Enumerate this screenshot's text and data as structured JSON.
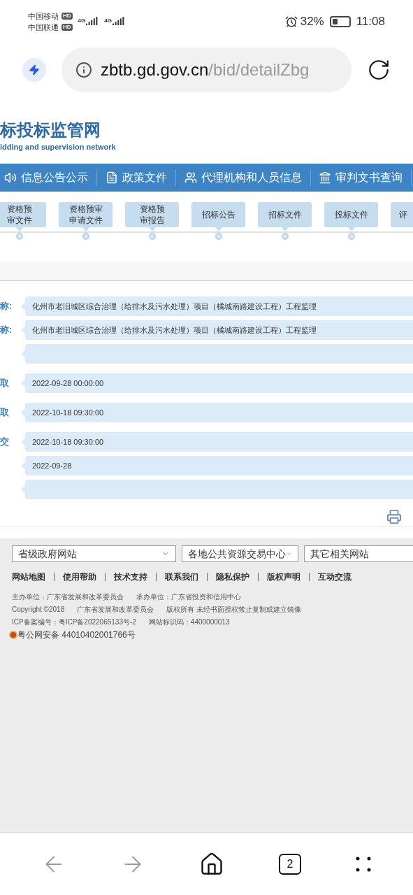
{
  "status_bar": {
    "carriers": [
      {
        "name": "中国移动",
        "badge": "HD"
      },
      {
        "name": "中国联通",
        "badge": "HD"
      }
    ],
    "networks": [
      "4G",
      "4G"
    ],
    "battery": "32%",
    "time": "11:08"
  },
  "address_bar": {
    "domain": "zbtb.gd.gov.cn",
    "path": "/bid/detailZbg"
  },
  "site_header": {
    "title": "标投标监管网",
    "subtitle": "idding and supervision network"
  },
  "nav": [
    {
      "label": "信息公告公示"
    },
    {
      "label": "政策文件"
    },
    {
      "label": "代理机构和人员信息"
    },
    {
      "label": "审判文书查询"
    }
  ],
  "steps": [
    "资格预审文件",
    "资格预审申请文件",
    "资格预审报告",
    "招标公告",
    "招标文件",
    "投标文件",
    "评"
  ],
  "form_rows": [
    {
      "label": "称:",
      "value": "化州市老旧城区综合治理（给排水及污水处理）项目（橘城南路建设工程）工程监理"
    },
    {
      "label": "称:",
      "value": "化州市老旧城区综合治理（给排水及污水处理）项目（橘城南路建设工程）工程监理"
    },
    {
      "label": "",
      "value": ""
    },
    {
      "label": "取",
      "value": "2022-09-28 00:00:00"
    },
    {
      "label": "取",
      "value": "2022-10-18 09:30:00"
    },
    {
      "label": "交",
      "value": "2022-10-18 09:30:00"
    },
    {
      "label": "",
      "value": "2022-09-28"
    },
    {
      "label": "",
      "value": ""
    }
  ],
  "footer": {
    "selects": [
      "省级政府网站",
      "各地公共资源交易中心",
      "其它相关网站"
    ],
    "links": [
      "网站地图",
      "使用帮助",
      "技术支持",
      "联系我们",
      "隐私保护",
      "版权声明",
      "互动交流"
    ],
    "info_lines": [
      [
        "主办单位：广东省发展和改革委员会",
        "承办单位：广东省投资和信用中心"
      ],
      [
        "Copyright ©2018",
        "广东省发展和改革委员会",
        "版权所有 未经书面授权禁止复制或建立镜像"
      ],
      [
        "ICP备案编号：粤ICP备2022065133号-2",
        "网站标识码：4400000013"
      ]
    ],
    "police_record": "粤公网安备 44010402001766号"
  },
  "bottom_bar": {
    "tab_count": "2"
  }
}
